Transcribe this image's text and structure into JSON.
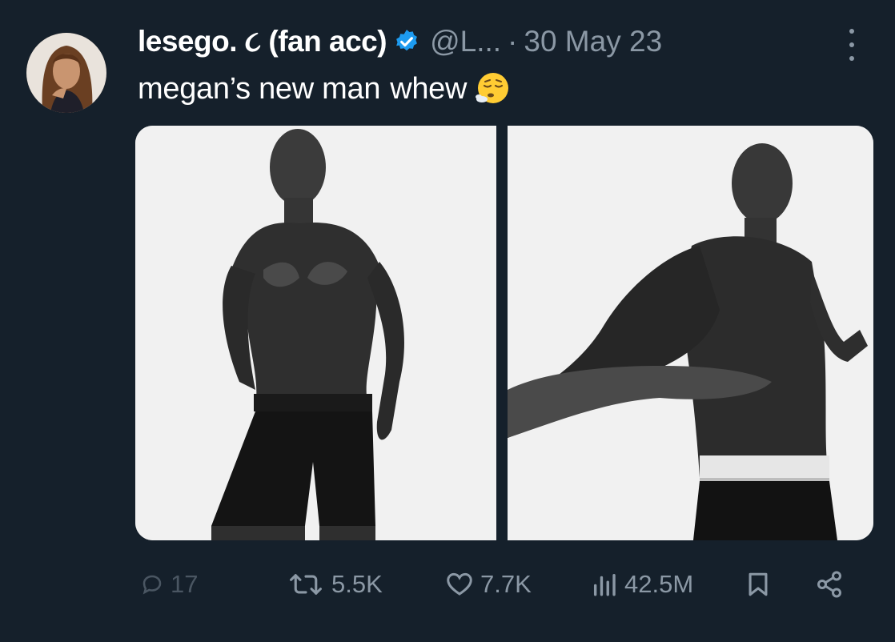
{
  "tweet": {
    "display_name": "lesego. ૮ (fan acc)",
    "handle": "@L...",
    "separator": "·",
    "date": "30 May 23",
    "text": "megan’s new man",
    "text_suffix": "whew",
    "verified_color": "#1d9bf0"
  },
  "metrics": {
    "replies": "17",
    "reposts": "5.5K",
    "likes": "7.7K",
    "views": "42.5M"
  },
  "icons": {
    "more": "more-options-icon",
    "reply": "reply-icon",
    "repost": "repost-icon",
    "like": "heart-icon",
    "views": "views-chart-icon",
    "bookmark": "bookmark-icon",
    "share": "share-icon",
    "emoji": "face-exhaling-emoji"
  },
  "colors": {
    "background": "#15202b",
    "muted": "#8b98a5",
    "text": "#ffffff"
  }
}
